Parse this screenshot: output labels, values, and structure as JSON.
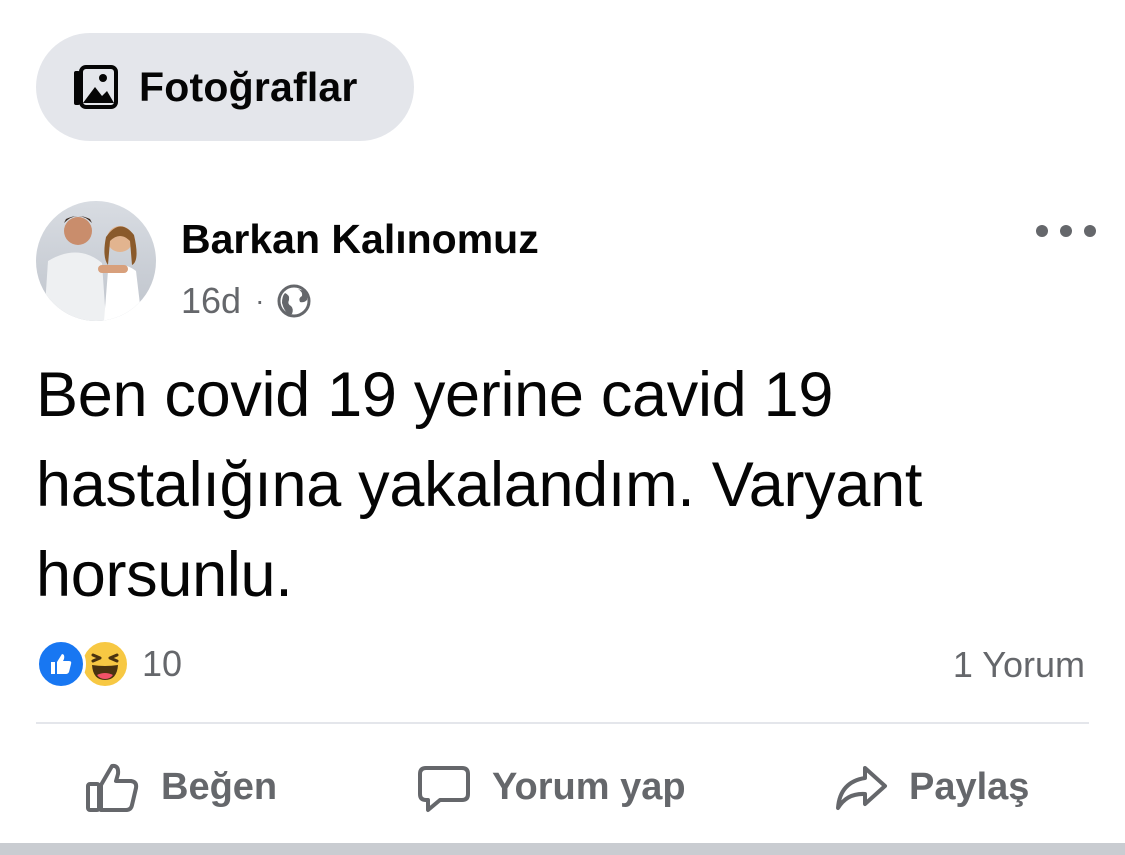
{
  "photos_chip": {
    "label": "Fotoğraflar",
    "icon": "photos-icon"
  },
  "post": {
    "author": "Barkan Kalınomuz",
    "time": "16d",
    "separator": "·",
    "privacy_icon": "globe-icon",
    "text": "Ben covid 19 yerine cavid 19 hastalığına yakalandım. Varyant horsunlu.",
    "reactions": {
      "types": [
        "like",
        "haha"
      ],
      "count": "10",
      "like_color": "#1877f2",
      "haha_color": "#f7c843"
    },
    "comments_label": "1 Yorum"
  },
  "actions": {
    "like": "Beğen",
    "comment": "Yorum yap",
    "share": "Paylaş"
  },
  "colors": {
    "text_primary": "#050505",
    "text_secondary": "#65676b",
    "chip_bg": "#e4e6eb",
    "divider": "#e4e6eb"
  }
}
